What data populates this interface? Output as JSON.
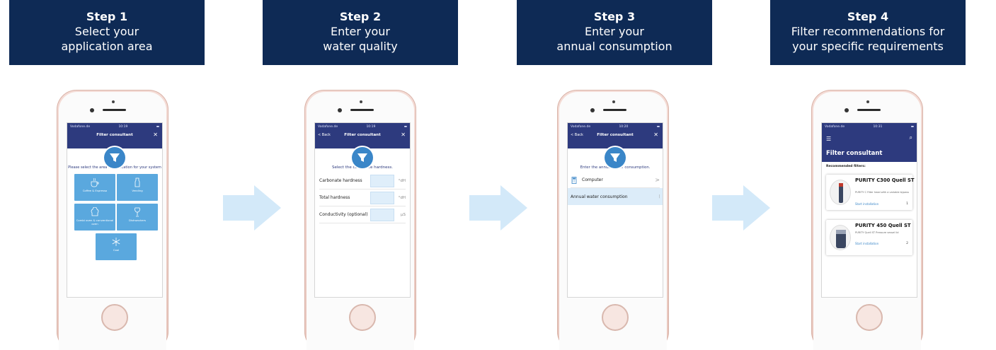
{
  "steps": [
    {
      "step": "Step 1",
      "line1": "Select your",
      "line2": "application area"
    },
    {
      "step": "Step 2",
      "line1": "Enter your",
      "line2": "water quality"
    },
    {
      "step": "Step 3",
      "line1": "Enter your",
      "line2": "annual consumption"
    },
    {
      "step": "Step 4",
      "line1": "Filter recommendations for",
      "line2": "your specific requirements"
    }
  ],
  "phones": {
    "p1": {
      "status_left": "Vodafone.de",
      "time": "10:19",
      "title": "Filter consultant",
      "close": "✕",
      "prompt": "Please select the area of application for your system",
      "tiles": [
        "Coffee & Espresso",
        "Vending",
        "Combi oven & conventional oven",
        "Dishwashers",
        "Cool"
      ]
    },
    "p2": {
      "status_left": "Vodafone.de",
      "time": "10:19",
      "back": "< Back",
      "title": "Filter consultant",
      "close": "✕",
      "prompt": "Select the carbonate hardness.",
      "rows": [
        {
          "label": "Carbonate hardness",
          "unit": "°dH"
        },
        {
          "label": "Total hardness",
          "unit": "°dH"
        },
        {
          "label": "Conductivity (optional)",
          "unit": "µS"
        }
      ]
    },
    "p3": {
      "status_left": "Vodafone.de",
      "time": "10:20",
      "back": "< Back",
      "title": "Filter consultant",
      "close": "✕",
      "prompt": "Enter the annual water consumption.",
      "computer": "Computer",
      "chevron": ">",
      "annual": "Annual water consumption",
      "annual_mark": "|"
    },
    "p4": {
      "status_left": "Vodafone.de",
      "time": "10:31",
      "title": "Filter consultant",
      "recommended": "Recommended filters:",
      "cards": [
        {
          "name": "PURITY C300 Quell ST",
          "desc": "PURITY C Filter head with a variable bypass",
          "start": "Start installation",
          "num": "1"
        },
        {
          "name": "PURITY 450 Quell ST",
          "desc": "PURITY Quell ST Pressure vessel lid",
          "start": "Start installation",
          "num": "2"
        }
      ]
    }
  },
  "colors": {
    "banner": "#0e2a55",
    "app_header": "#2d3a7e",
    "accent": "#3a86c8",
    "tile": "#5aa8de",
    "arrow": "#d3e9f9"
  }
}
